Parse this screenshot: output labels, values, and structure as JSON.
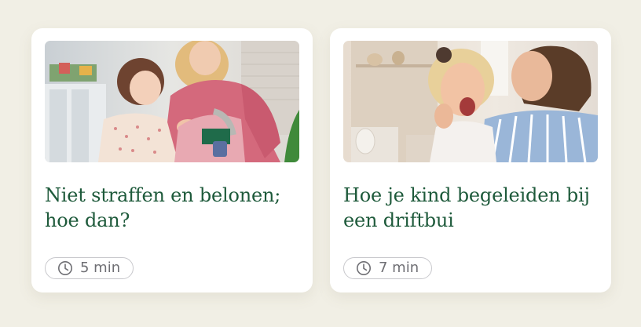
{
  "colors": {
    "background": "#f1efe5",
    "card": "#ffffff",
    "title": "#1e5a3b",
    "badge_border": "#c8c8cc",
    "badge_text": "#6f6f74"
  },
  "articles": [
    {
      "title": "Niet straffen en belonen; hoe dan?",
      "reading_time": "5 min",
      "icon": "clock-icon"
    },
    {
      "title": "Hoe je kind begeleiden bij een driftbui",
      "reading_time": "7 min",
      "icon": "clock-icon"
    }
  ]
}
